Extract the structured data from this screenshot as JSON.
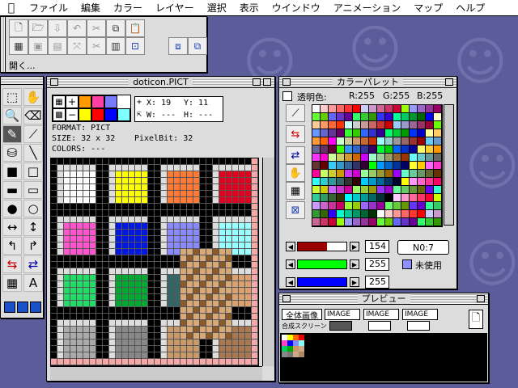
{
  "menubar": {
    "items": [
      "ファイル",
      "編集",
      "カラー",
      "レイヤー",
      "選択",
      "表示",
      "ウインドウ",
      "アニメーション",
      "マップ",
      "ヘルプ"
    ]
  },
  "toolbar_window": {
    "status_text": "開く..."
  },
  "canvas_window": {
    "title": "doticon.PICT",
    "coord_x": "X: 19",
    "coord_y": "Y: 11",
    "size_w": "W: ---",
    "size_h": "H: ---",
    "format": "FORMAT: PICT",
    "size": "SIZE: 32 x 32",
    "pixelbit": "PixelBit: 32",
    "colors": "COLORS: ---"
  },
  "palette_window": {
    "title": "カラーパレット",
    "transparent_label": "透明色:",
    "r": "R:255",
    "g": "G:255",
    "b": "B:255",
    "red_value": "154",
    "green_value": "255",
    "blue_value": "255",
    "index_label": "N0:7",
    "unused_label": "未使用"
  },
  "preview_window": {
    "title": "プレビュー",
    "all_image_button": "全体画像",
    "composite_label": "合成スクリーン",
    "image_select_1": "IMAGE",
    "image_select_2": "IMAGE",
    "image_select_3": "IMAGE"
  },
  "colors": {
    "desktop": "#5b5d9a",
    "slider_red": "#9a0000",
    "slider_green": "#00ff00",
    "slider_blue": "#0000ff"
  }
}
